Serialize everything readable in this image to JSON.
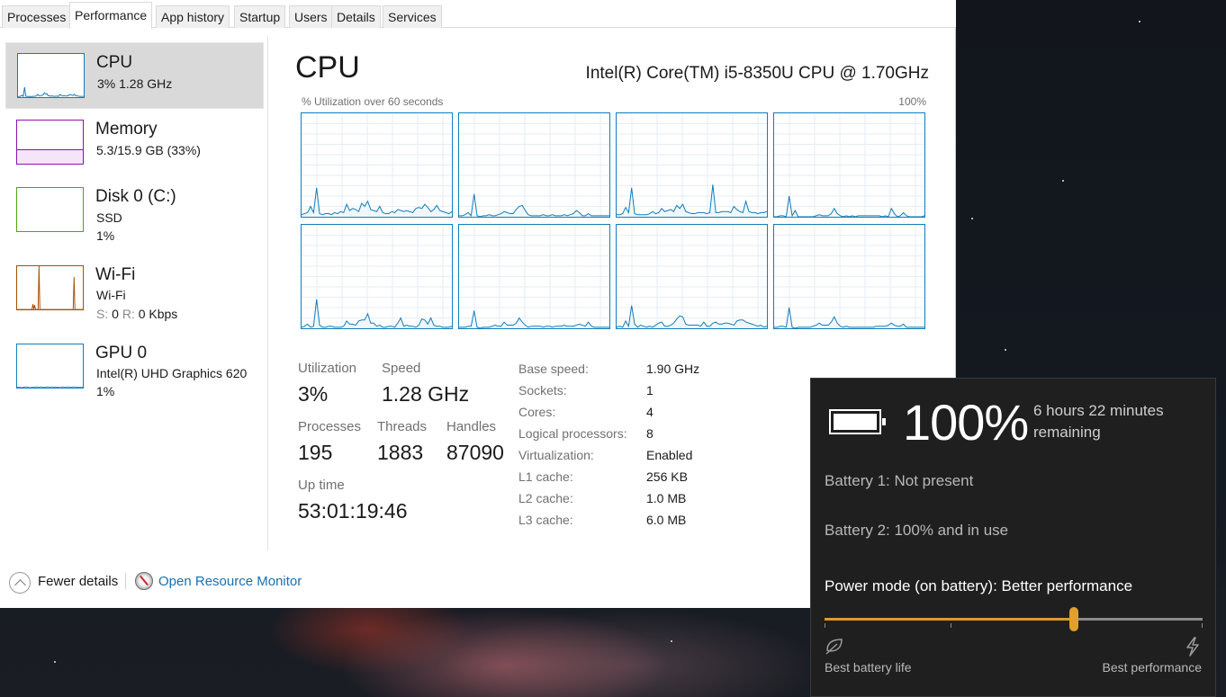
{
  "tabs": [
    {
      "label": "Processes",
      "active": false
    },
    {
      "label": "Performance",
      "active": true
    },
    {
      "label": "App history",
      "active": false
    },
    {
      "label": "Startup",
      "active": false
    },
    {
      "label": "Users",
      "active": false
    },
    {
      "label": "Details",
      "active": false
    },
    {
      "label": "Services",
      "active": false
    }
  ],
  "sidebar": {
    "items": [
      {
        "title": "CPU",
        "line1": "3%  1.28 GHz",
        "line2": "",
        "color": "#117dbb",
        "selected": true
      },
      {
        "title": "Memory",
        "line1": "5.3/15.9 GB (33%)",
        "line2": "",
        "color": "#8b12ae",
        "selected": false
      },
      {
        "title": "Disk 0 (C:)",
        "line1": "SSD",
        "line2": "1%",
        "color": "#4da60c",
        "selected": false
      },
      {
        "title": "Wi-Fi",
        "line1": "Wi-Fi",
        "line2_send_label": "S:",
        "line2_send_value": "0",
        "line2_recv_label": "R:",
        "line2_recv_value": "0 Kbps",
        "color": "#a74f01",
        "selected": false
      },
      {
        "title": "GPU 0",
        "line1": "Intel(R) UHD Graphics 620",
        "line2": "1%",
        "color": "#117dbb",
        "selected": false
      }
    ]
  },
  "main": {
    "title": "CPU",
    "model": "Intel(R) Core(TM) i5-8350U CPU @ 1.70GHz",
    "graph_caption": "% Utilization over 60 seconds",
    "graph_max": "100%",
    "stats": {
      "utilization": {
        "label": "Utilization",
        "value": "3%"
      },
      "speed": {
        "label": "Speed",
        "value": "1.28 GHz"
      },
      "processes": {
        "label": "Processes",
        "value": "195"
      },
      "threads": {
        "label": "Threads",
        "value": "1883"
      },
      "handles": {
        "label": "Handles",
        "value": "87090"
      },
      "uptime": {
        "label": "Up time",
        "value": "53:01:19:46"
      }
    },
    "specs": [
      {
        "label": "Base speed:",
        "value": "1.90 GHz"
      },
      {
        "label": "Sockets:",
        "value": "1"
      },
      {
        "label": "Cores:",
        "value": "4"
      },
      {
        "label": "Logical processors:",
        "value": "8"
      },
      {
        "label": "Virtualization:",
        "value": "Enabled"
      },
      {
        "label": "L1 cache:",
        "value": "256 KB"
      },
      {
        "label": "L2 cache:",
        "value": "1.0 MB"
      },
      {
        "label": "L3 cache:",
        "value": "6.0 MB"
      }
    ]
  },
  "chart_data": {
    "type": "line",
    "title": "% Utilization over 60 seconds",
    "ylim": [
      0,
      100
    ],
    "xlim": [
      0,
      60
    ],
    "y_max_label": "100%",
    "grid": true,
    "series": [
      {
        "name": "CPU 0",
        "values": [
          2,
          3,
          4,
          10,
          4,
          28,
          3,
          2,
          3,
          3,
          2,
          4,
          3,
          5,
          4,
          12,
          6,
          8,
          7,
          5,
          13,
          10,
          15,
          7,
          6,
          5,
          10,
          4,
          3,
          3,
          5,
          4,
          7,
          6,
          5,
          6,
          5,
          4,
          8,
          9,
          8,
          12,
          9,
          5,
          7,
          11,
          6,
          5,
          4,
          3,
          5
        ]
      },
      {
        "name": "CPU 1",
        "values": [
          1,
          1,
          2,
          4,
          1,
          22,
          1,
          0,
          1,
          1,
          2,
          1,
          1,
          2,
          3,
          5,
          4,
          3,
          3,
          7,
          10,
          11,
          6,
          2,
          1,
          1,
          1,
          1,
          2,
          1,
          1,
          2,
          1,
          1,
          1,
          2,
          1,
          2,
          3,
          6,
          4,
          1,
          1,
          3,
          1,
          1,
          1,
          1,
          1,
          1,
          1
        ]
      },
      {
        "name": "CPU 2",
        "values": [
          2,
          2,
          3,
          9,
          4,
          28,
          3,
          2,
          2,
          2,
          2,
          3,
          5,
          3,
          4,
          8,
          5,
          6,
          7,
          5,
          11,
          8,
          12,
          5,
          4,
          3,
          3,
          4,
          4,
          4,
          3,
          4,
          31,
          4,
          4,
          5,
          5,
          5,
          4,
          10,
          7,
          5,
          4,
          15,
          5,
          4,
          4,
          3,
          4,
          4,
          5
        ]
      },
      {
        "name": "CPU 3",
        "values": [
          0,
          0,
          1,
          1,
          0,
          20,
          1,
          6,
          0,
          0,
          0,
          0,
          0,
          0,
          1,
          2,
          1,
          1,
          1,
          3,
          8,
          3,
          1,
          0,
          1,
          0,
          1,
          0,
          1,
          1,
          1,
          1,
          1,
          1,
          1,
          1,
          0,
          1,
          0,
          8,
          3,
          0,
          1,
          4,
          1,
          0,
          0,
          0,
          0,
          0,
          1
        ]
      },
      {
        "name": "CPU 4",
        "values": [
          1,
          2,
          4,
          1,
          2,
          28,
          3,
          1,
          1,
          2,
          2,
          1,
          1,
          1,
          2,
          7,
          4,
          4,
          3,
          7,
          8,
          8,
          14,
          5,
          5,
          2,
          3,
          1,
          1,
          2,
          2,
          1,
          5,
          10,
          2,
          3,
          2,
          2,
          1,
          3,
          9,
          8,
          4,
          10,
          3,
          2,
          2,
          1,
          1,
          1,
          2
        ]
      },
      {
        "name": "CPU 5",
        "values": [
          1,
          1,
          1,
          2,
          2,
          17,
          1,
          0,
          1,
          1,
          1,
          2,
          3,
          2,
          2,
          6,
          3,
          3,
          3,
          5,
          10,
          6,
          3,
          1,
          2,
          2,
          2,
          2,
          1,
          2,
          2,
          1,
          2,
          2,
          2,
          3,
          2,
          2,
          2,
          3,
          4,
          3,
          2,
          6,
          2,
          1,
          1,
          1,
          1,
          1,
          1
        ]
      },
      {
        "name": "CPU 6",
        "values": [
          1,
          2,
          1,
          7,
          2,
          22,
          4,
          1,
          3,
          2,
          1,
          2,
          1,
          3,
          5,
          6,
          2,
          2,
          3,
          5,
          9,
          12,
          11,
          4,
          3,
          3,
          3,
          3,
          2,
          6,
          2,
          2,
          5,
          6,
          4,
          4,
          5,
          5,
          4,
          3,
          7,
          8,
          8,
          6,
          5,
          4,
          3,
          2,
          3,
          1,
          2
        ]
      },
      {
        "name": "CPU 7",
        "values": [
          1,
          1,
          2,
          2,
          1,
          20,
          1,
          0,
          1,
          1,
          1,
          1,
          1,
          2,
          3,
          5,
          3,
          3,
          3,
          6,
          11,
          5,
          2,
          1,
          2,
          1,
          1,
          1,
          1,
          1,
          1,
          1,
          1,
          1,
          2,
          2,
          2,
          2,
          3,
          5,
          3,
          2,
          2,
          4,
          1,
          1,
          1,
          1,
          1,
          1,
          1
        ]
      }
    ]
  },
  "footer": {
    "fewer_details": "Fewer details",
    "open_resource_monitor": "Open Resource Monitor"
  },
  "battery_flyout": {
    "percent": "100%",
    "remaining": "6 hours 22 minutes remaining",
    "battery1": "Battery 1: Not present",
    "battery2": "Battery 2: 100% and in use",
    "power_mode": "Power mode (on battery): Better performance",
    "slider_level": 0.66,
    "left_label": "Best battery life",
    "right_label": "Best performance",
    "accent": "#e0a030"
  }
}
